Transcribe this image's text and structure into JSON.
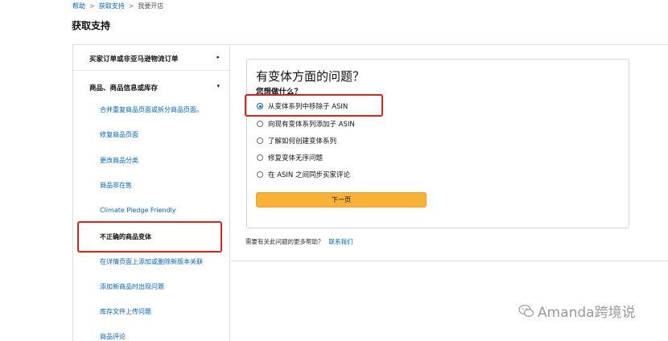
{
  "breadcrumb": {
    "home": "帮助",
    "sep": ">",
    "level2": "获取支持",
    "level3": "我要开店"
  },
  "page_title": "获取支持",
  "sidebar": {
    "section1": {
      "label": "买家订单或非亚马逊物流订单",
      "arrow": "▸"
    },
    "section2": {
      "label": "商品、商品信息或库存",
      "arrow": "▾"
    },
    "items": [
      {
        "label": "合并重复商品页面或拆分商品页面。"
      },
      {
        "label": "修复商品页面"
      },
      {
        "label": "更改商品分类"
      },
      {
        "label": "商品非在售"
      },
      {
        "label": "Climate Pledge Friendly"
      },
      {
        "label": "不正确的商品变体"
      },
      {
        "label": "在详情页面上添加或删除新版本关联"
      },
      {
        "label": "添加新商品时出现问题"
      },
      {
        "label": "库存文件上传问题"
      },
      {
        "label": "商品评论"
      }
    ]
  },
  "panel": {
    "title": "有变体方面的问题？",
    "subtitle": "您想做什么？",
    "options": [
      {
        "label": "从变体系列中移除子 ASIN",
        "checked": true
      },
      {
        "label": "向现有变体系列添加子 ASIN",
        "checked": false
      },
      {
        "label": "了解如何创建变体系列",
        "checked": false
      },
      {
        "label": "修复变体无序问题",
        "checked": false
      },
      {
        "label": "在 ASIN 之间同步买家评论",
        "checked": false
      }
    ],
    "next_button": "下一页"
  },
  "help": {
    "text": "需要有关此问题的更多帮助？",
    "link": "联系我们"
  },
  "watermark": {
    "text": "Amanda跨境说",
    "icon": "wechat-icon"
  },
  "colors": {
    "link": "#0066c0",
    "button": "#f8b238",
    "highlight": "#e0211b"
  }
}
